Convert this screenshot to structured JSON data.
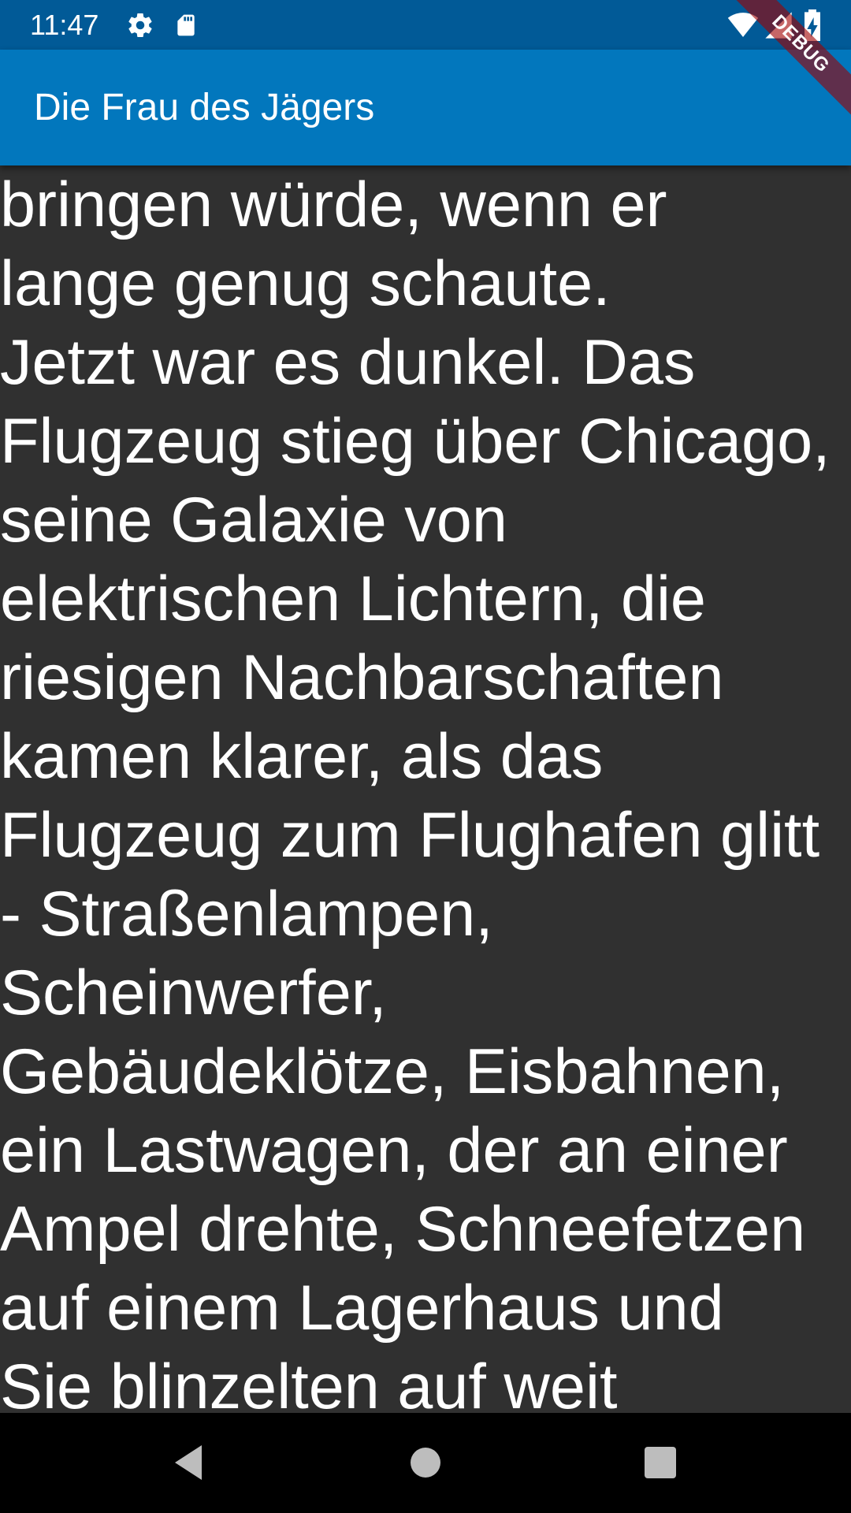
{
  "status_bar": {
    "time": "11:47",
    "icons": [
      "gear-icon",
      "sd-card-icon",
      "wifi-icon",
      "cell-signal-icon",
      "battery-charging-icon"
    ]
  },
  "app_bar": {
    "title": "Die Frau des Jägers"
  },
  "debug_banner": {
    "label": "DEBUG"
  },
  "content": {
    "lines": [
      "bringen würde, wenn er",
      "lange genug schaute.",
      "Jetzt war es dunkel. Das",
      "Flugzeug stieg über Chicago,",
      "seine Galaxie von",
      "elektrischen Lichtern, die",
      "riesigen Nachbarschaften",
      "kamen klarer, als das",
      "Flugzeug zum Flughafen glitt",
      "- Straßenlampen,",
      "Scheinwerfer,",
      "Gebäudeklötze, Eisbahnen,",
      "ein Lastwagen, der an einer",
      "Ampel drehte, Schneefetzen",
      "auf einem Lagerhaus und",
      "Sie blinzelten auf weit"
    ]
  },
  "nav_bar": {
    "icons": [
      "back-icon",
      "home-icon",
      "recents-icon"
    ]
  },
  "colors": {
    "status_bar": "#015a97",
    "app_bar": "#0277bd",
    "background": "#303030",
    "text": "#ffffff",
    "nav_bar": "#000000"
  }
}
